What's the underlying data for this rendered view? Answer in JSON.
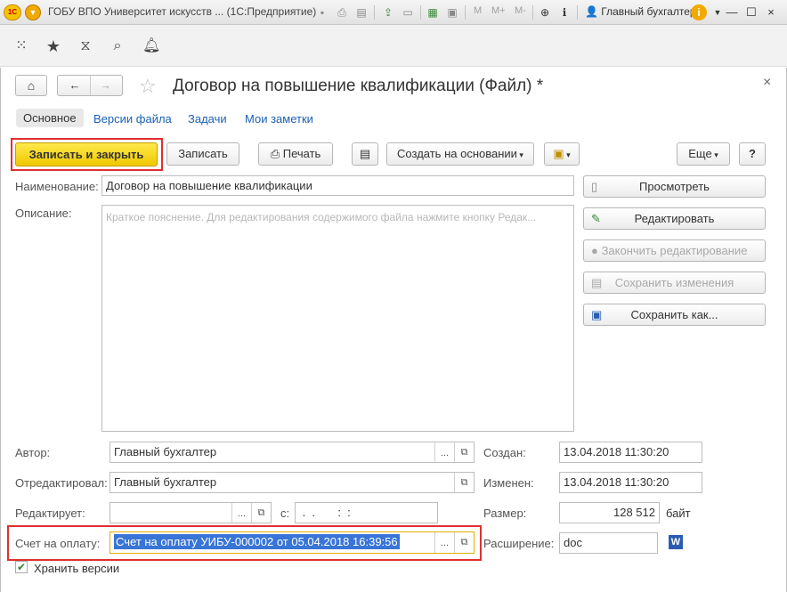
{
  "window": {
    "title": "ГОБУ ВПО Университет искусств ... (1С:Предприятие)",
    "user": "Главный бухгалтер",
    "mm": [
      "M",
      "M+",
      "M-"
    ],
    "close": "×"
  },
  "doc": {
    "title": "Договор на повышение квалификации (Файл) *",
    "close": "×"
  },
  "tabs": [
    "Основное",
    "Версии файла",
    "Задачи",
    "Мои заметки"
  ],
  "toolbar": {
    "save_close": "Записать и закрыть",
    "save": "Записать",
    "print": "Печать",
    "create_based": "Создать на основании",
    "more": "Еще",
    "help": "?"
  },
  "form": {
    "name_label": "Наименование:",
    "name_value": "Договор на повышение квалификации",
    "desc_label": "Описание:",
    "desc_placeholder": "Краткое пояснение. Для редактирования содержимого файла нажмите кнопку Редак...",
    "author_label": "Автор:",
    "author_value": "Главный бухгалтер",
    "edited_by_label": "Отредактировал:",
    "edited_by_value": "Главный бухгалтер",
    "editing_label": "Редактирует:",
    "editing_value": "",
    "since_label": "с:",
    "since_value": " .  .       :  :",
    "invoice_label": "Счет на оплату:",
    "invoice_value": "Счет на оплату УИБУ-000002 от 05.04.2018 16:39:56",
    "created_label": "Создан:",
    "created_value": "13.04.2018 11:30:20",
    "changed_label": "Изменен:",
    "changed_value": "13.04.2018 11:30:20",
    "size_label": "Размер:",
    "size_value": "128 512",
    "size_unit": "байт",
    "ext_label": "Расширение:",
    "ext_value": "doc",
    "keep_versions_label": "Хранить версии",
    "select_glyph": "...",
    "open_glyph": "⧉"
  },
  "actions": {
    "view": "Просмотреть",
    "edit": "Редактировать",
    "finish_edit": "Закончить редактирование",
    "save_changes": "Сохранить изменения",
    "save_as": "Сохранить как..."
  },
  "colors": {
    "accent_yellow": "#f0c800",
    "link_blue": "#1a5fb4",
    "highlight": "#3875d7",
    "red_frame": "#e03030"
  }
}
